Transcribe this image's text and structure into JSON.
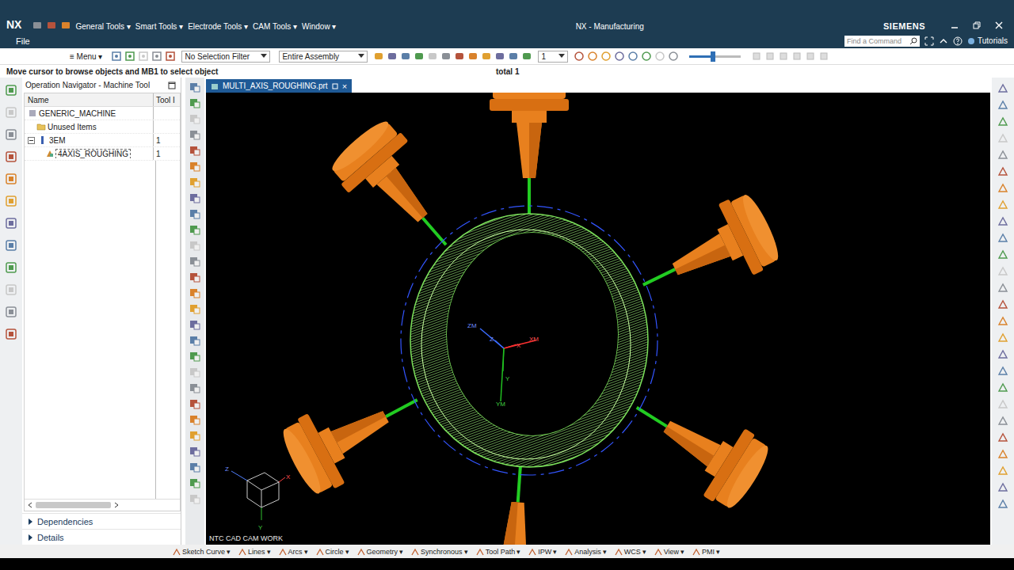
{
  "window": {
    "logo": "NX",
    "title": "NX - Manufacturing",
    "brand": "SIEMENS"
  },
  "quick_access": [
    {
      "label": "General Tools",
      "caret": "▾"
    },
    {
      "label": "Smart Tools",
      "caret": "▾"
    },
    {
      "label": "Electrode Tools",
      "caret": "▾"
    },
    {
      "label": "CAM Tools",
      "caret": "▾"
    },
    {
      "label": "Window",
      "caret": "▾"
    }
  ],
  "file_menu": {
    "label": "File"
  },
  "command_finder": {
    "placeholder": "Find a Command"
  },
  "tutorials": {
    "label": "Tutorials"
  },
  "toolbar": {
    "menu": {
      "icon": "≡",
      "label": "Menu",
      "caret": "▾"
    },
    "selection_filter": "No Selection Filter",
    "scope": "Entire Assembly",
    "layer": "1",
    "zoom_level": 0.45
  },
  "status": {
    "prompt": "Move cursor to browse objects and MB1 to select object",
    "selection_count": "total 1"
  },
  "navigator": {
    "title": "Operation Navigator - Machine Tool",
    "columns": [
      "Name",
      "Tool I"
    ],
    "rows": [
      {
        "name": "GENERIC_MACHINE",
        "tool": "",
        "depth": 0,
        "kind": "machine",
        "has_children": false,
        "expanded": false,
        "selected": false
      },
      {
        "name": "Unused Items",
        "tool": "",
        "depth": 1,
        "kind": "folder",
        "has_children": false,
        "expanded": false,
        "selected": false
      },
      {
        "name": "3EM",
        "tool": "1",
        "depth": 0,
        "kind": "tool",
        "has_children": true,
        "expanded": true,
        "selected": false
      },
      {
        "name": "4AXIS_ROUGHING",
        "tool": "1",
        "depth": 2,
        "kind": "operation",
        "has_children": false,
        "expanded": false,
        "selected": true
      }
    ],
    "sections": [
      {
        "label": "Dependencies",
        "expanded": false
      },
      {
        "label": "Details",
        "expanded": false
      }
    ]
  },
  "document_tab": {
    "label": "MULTI_AXIS_ROUGHING.prt",
    "close": "×"
  },
  "viewport": {
    "watermark": "NTC CAD CAM WORK",
    "mcs_labels": {
      "zm": "ZM",
      "z": "Z",
      "xm": "XM",
      "x": "X",
      "y": "Y",
      "ym": "YM"
    },
    "view_triad": {
      "x": "X",
      "y": "Y",
      "z": "Z"
    }
  },
  "bottom_menus": [
    {
      "label": "Sketch Curve",
      "caret": "▾"
    },
    {
      "label": "Lines",
      "caret": "▾"
    },
    {
      "label": "Arcs",
      "caret": "▾"
    },
    {
      "label": "Circle",
      "caret": "▾"
    },
    {
      "label": "Geometry",
      "caret": "▾"
    },
    {
      "label": "Synchronous",
      "caret": "▾"
    },
    {
      "label": "Tool Path",
      "caret": "▾"
    },
    {
      "label": "IPW",
      "caret": "▾"
    },
    {
      "label": "Analysis",
      "caret": "▾"
    },
    {
      "label": "WCS",
      "caret": "▾"
    },
    {
      "label": "View",
      "caret": "▾"
    },
    {
      "label": "PMI",
      "caret": "▾"
    }
  ]
}
